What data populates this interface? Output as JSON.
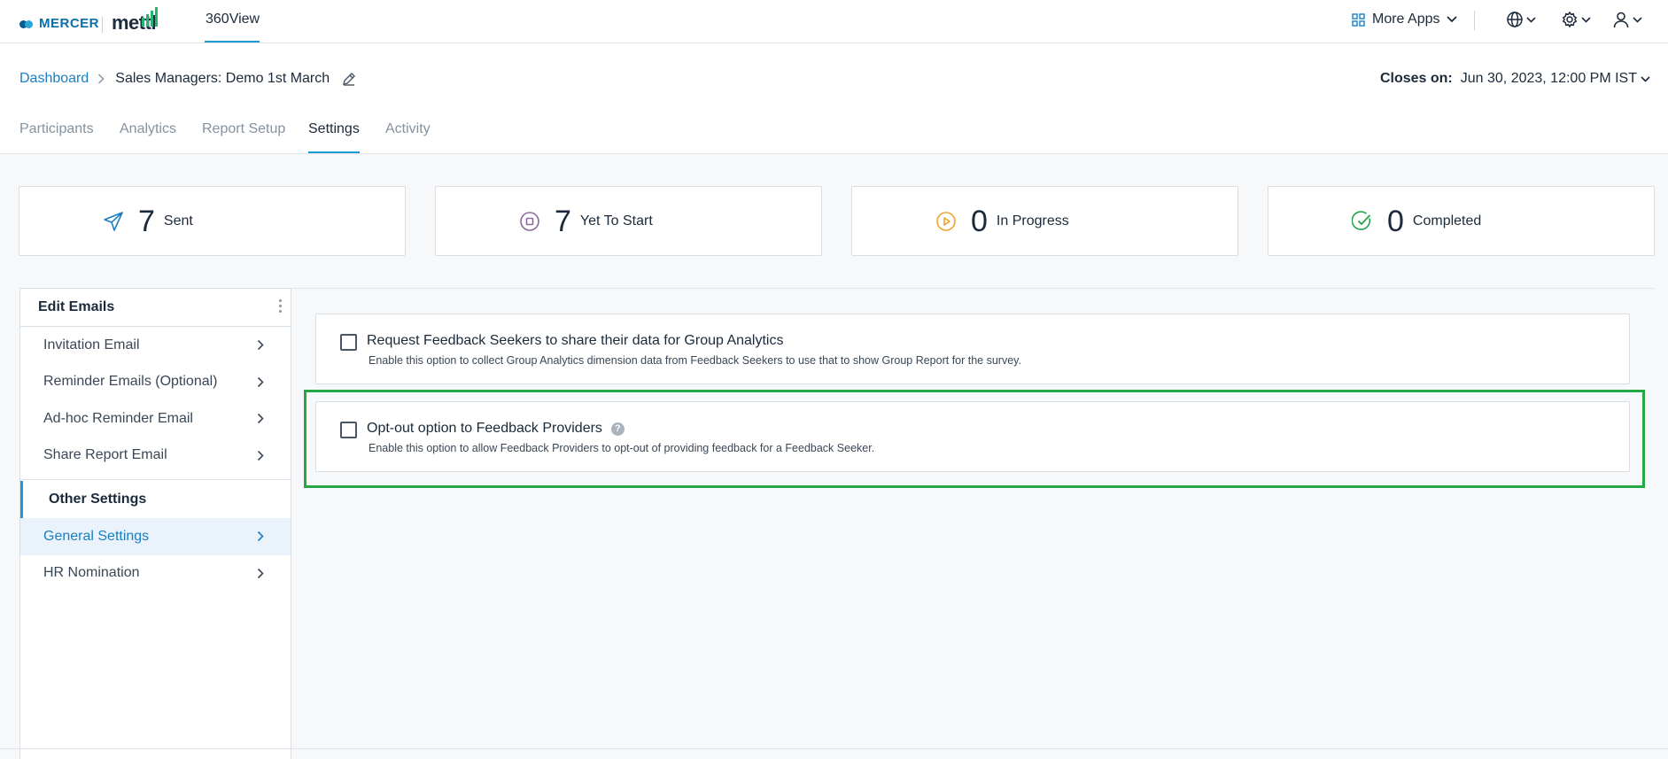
{
  "topbar": {
    "brand_mercer": "MERCER",
    "brand_mettl": "mettl",
    "app_tab": "360View",
    "more_apps": "More Apps",
    "icons": [
      "apps-grid-icon",
      "globe-icon",
      "gear-icon",
      "user-icon"
    ]
  },
  "breadcrumb": {
    "root": "Dashboard",
    "current": "Sales Managers: Demo 1st March"
  },
  "closes": {
    "label": "Closes on:",
    "value": "Jun 30, 2023, 12:00 PM IST"
  },
  "tabs": [
    {
      "label": "Participants"
    },
    {
      "label": "Analytics"
    },
    {
      "label": "Report Setup"
    },
    {
      "label": "Settings",
      "active": true
    },
    {
      "label": "Activity"
    }
  ],
  "stats": [
    {
      "value": "7",
      "label": "Sent",
      "color": "#1a7fc1"
    },
    {
      "value": "7",
      "label": "Yet To Start",
      "color": "#8b6a9f"
    },
    {
      "value": "0",
      "label": "In Progress",
      "color": "#f2a22a"
    },
    {
      "value": "0",
      "label": "Completed",
      "color": "#22a34a"
    }
  ],
  "sidebar": {
    "header": "Edit Emails",
    "email_items": [
      {
        "label": "Invitation Email"
      },
      {
        "label": "Reminder Emails (Optional)"
      },
      {
        "label": "Ad-hoc Reminder Email"
      },
      {
        "label": "Share Report Email"
      }
    ],
    "section": "Other Settings",
    "other_items": [
      {
        "label": "General Settings",
        "active": true
      },
      {
        "label": "HR Nomination"
      }
    ]
  },
  "options": [
    {
      "title": "Request Feedback Seekers to share their data for Group Analytics",
      "description": "Enable this option to collect Group Analytics dimension data from Feedback Seekers to use that to show Group Report for the survey.",
      "checked": false
    },
    {
      "title": "Opt-out option to Feedback Providers",
      "description": "Enable this option to allow Feedback Providers to opt-out of providing feedback for a Feedback Seeker.",
      "checked": false,
      "help": "?"
    }
  ],
  "colors": {
    "accent": "#1a9ad6",
    "highlight": "#26a845"
  }
}
